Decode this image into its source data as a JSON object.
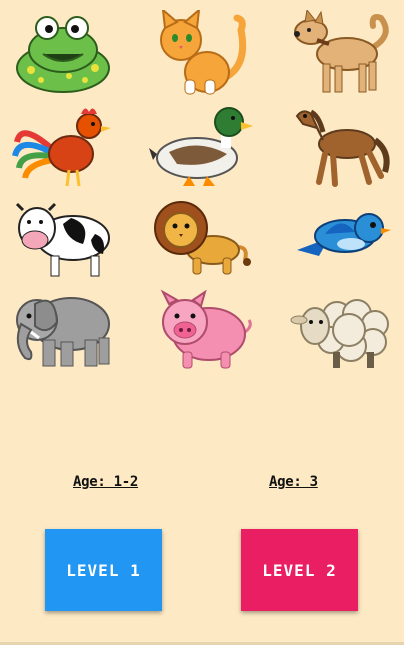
{
  "animals": [
    {
      "name": "frog",
      "icon": "frog-icon"
    },
    {
      "name": "cat",
      "icon": "cat-icon"
    },
    {
      "name": "dog",
      "icon": "dog-icon"
    },
    {
      "name": "rooster",
      "icon": "rooster-icon"
    },
    {
      "name": "duck",
      "icon": "duck-icon"
    },
    {
      "name": "horse",
      "icon": "horse-icon"
    },
    {
      "name": "cow",
      "icon": "cow-icon"
    },
    {
      "name": "lion",
      "icon": "lion-icon"
    },
    {
      "name": "bird",
      "icon": "bird-icon"
    },
    {
      "name": "elephant",
      "icon": "elephant-icon"
    },
    {
      "name": "pig",
      "icon": "pig-icon"
    },
    {
      "name": "sheep",
      "icon": "sheep-icon"
    }
  ],
  "levels": [
    {
      "age_label": "Age: 1-2",
      "button_label": "LEVEL 1",
      "color": "#2196f3"
    },
    {
      "age_label": "Age: 3",
      "button_label": "LEVEL 2",
      "color": "#e91e63"
    }
  ],
  "colors": {
    "background": "#fde9c4"
  }
}
